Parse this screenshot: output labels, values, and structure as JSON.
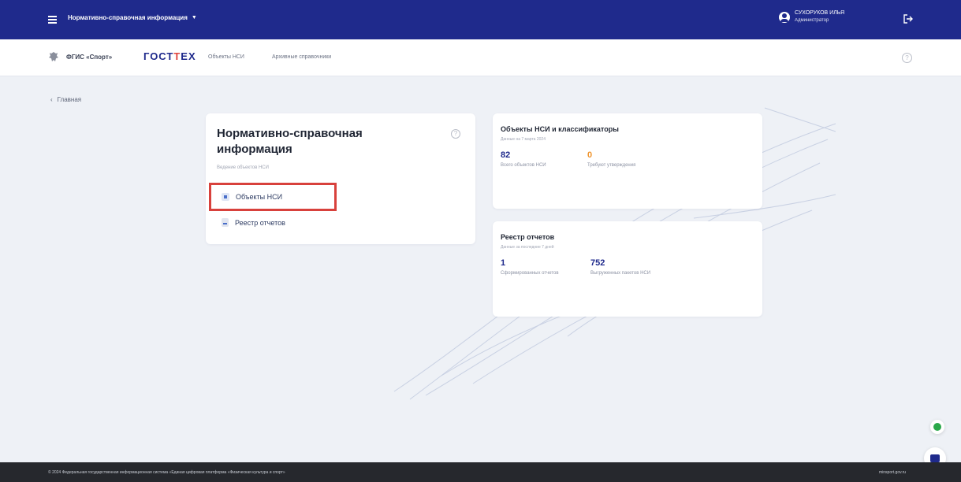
{
  "topbar": {
    "app_title": "Нормативно-справочная информация",
    "user_name": "СУХОРУКОВ ИЛЬЯ",
    "user_role": "Администратор"
  },
  "subnav": {
    "brand": "ФГИС «Спорт»",
    "gostex_left": "ГОСТ",
    "gostex_right": "ЕХ",
    "links": [
      "Объекты НСИ",
      "Архивные справочники"
    ]
  },
  "breadcrumb": {
    "back_label": "Главная"
  },
  "main_card": {
    "title": "Нормативно-справочная информация",
    "subtitle": "Ведение объектов НСИ",
    "link_nsi": "Объекты НСИ",
    "link_reestr": "Реестр отчетов"
  },
  "stat_nsi": {
    "title": "Объекты НСИ и классификаторы",
    "date": "Данные на 7 марта 2024",
    "total_value": "82",
    "total_label": "Всего объектов НСИ",
    "pending_value": "0",
    "pending_label": "Требуют утверждения"
  },
  "stat_reestr": {
    "title": "Реестр отчетов",
    "date": "Данные за последние 7 дней",
    "formed_value": "1",
    "formed_label": "Сформированных отчетов",
    "exported_value": "752",
    "exported_label": "Выгруженных пакетов НСИ"
  },
  "footer": {
    "copyright": "© 2024 Федеральная государственная информационная система «Единая цифровая платформа «Физическая культура и спорт»",
    "site": "minsport.gov.ru"
  },
  "colors": {
    "primary": "#1f2a8c",
    "accent_red": "#d8413c",
    "orange": "#f0952e"
  }
}
